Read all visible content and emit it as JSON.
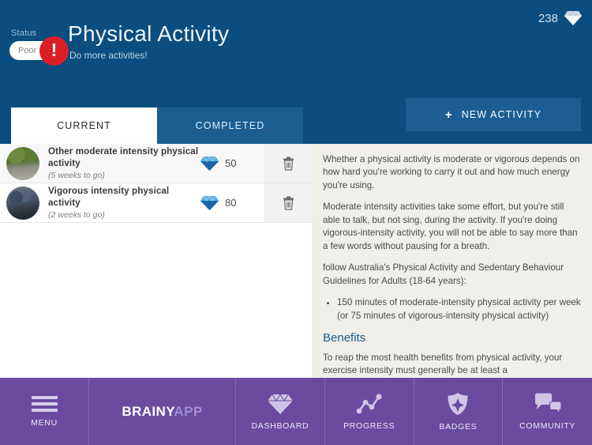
{
  "header": {
    "status_label": "Status",
    "status_value": "Poor",
    "alert_glyph": "!",
    "title": "Physical Activity",
    "subtitle": "Do more activities!",
    "gem_count": "238",
    "gem_icon": "diamond-icon"
  },
  "tabs": [
    {
      "label": "CURRENT",
      "active": true
    },
    {
      "label": "COMPLETED",
      "active": false
    }
  ],
  "new_activity": {
    "plus": "+",
    "label": "NEW ACTIVITY"
  },
  "activities": [
    {
      "title": "Other moderate intensity physical activity",
      "subtitle": "(5 weeks to go)",
      "points": "50",
      "gem_icon": "diamond-icon",
      "delete_icon": "trash-icon",
      "thumb_icon": "cycling-path-thumbnail"
    },
    {
      "title": "Vigorous intensity physical activity",
      "subtitle": "(2 weeks to go)",
      "points": "80",
      "gem_icon": "diamond-icon",
      "delete_icon": "trash-icon",
      "thumb_icon": "cycling-peloton-thumbnail"
    }
  ],
  "info": {
    "p1": "Whether a physical activity is moderate or vigorous depends on how hard you're working to carry it out and how much energy you're using.",
    "p2": "Moderate intensity activities take some effort, but you're still able to talk, but not sing, during the activity. If you're doing vigorous-intensity activity, you will not be able to say more than a few words without pausing for a breath.",
    "p3": "follow Australia's Physical Activity and Sedentary Behaviour Guidelines for Adults (18-64 years):",
    "bullet1": "150 minutes of moderate-intensity physical activity per week (or 75 minutes of vigorous-intensity physical activity)",
    "heading": "Benefits",
    "p4": "To reap the most health benefits from physical activity, your exercise intensity must generally be at least a"
  },
  "nav": {
    "menu_label": "MENU",
    "brand_primary": "BRAINY",
    "brand_secondary": "APP",
    "items": [
      {
        "label": "DASHBOARD",
        "icon": "diamond-icon"
      },
      {
        "label": "PROGRESS",
        "icon": "line-chart-icon"
      },
      {
        "label": "BADGES",
        "icon": "shield-icon"
      },
      {
        "label": "COMMUNITY",
        "icon": "chat-bubbles-icon"
      }
    ]
  },
  "colors": {
    "header_blue": "#0b4d7e",
    "tab_inactive": "#1b5e92",
    "accent_blue": "#1b5e92",
    "alert_red": "#dc1f26",
    "nav_purple": "#6a4ba0",
    "info_bg": "#f0efe9",
    "gem_blue": "#1f6fb8"
  }
}
